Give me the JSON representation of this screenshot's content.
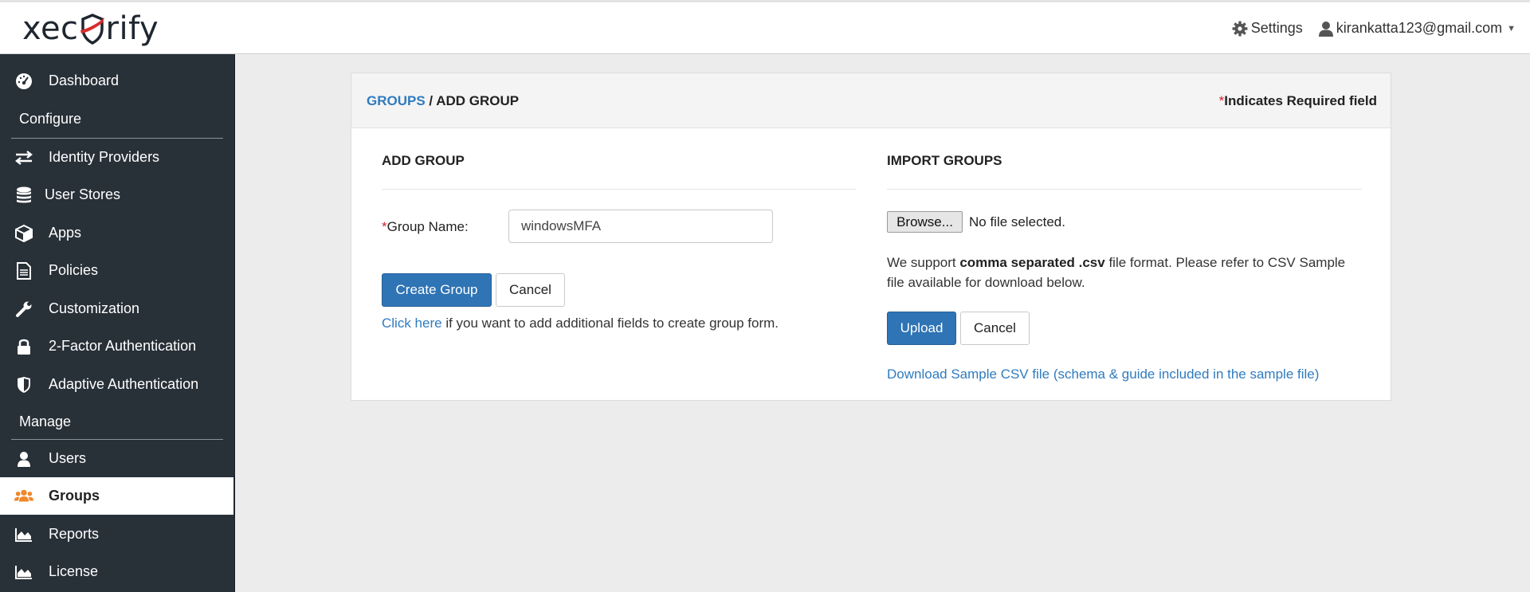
{
  "brand": {
    "logo_text_left": "xec",
    "logo_text_right": "rify",
    "accent": "#d92b2b"
  },
  "header": {
    "settings_label": "Settings",
    "user_email": "kirankatta123@gmail.com"
  },
  "sidebar": {
    "items": [
      {
        "label": "Dashboard",
        "icon": "dashboard-icon"
      },
      {
        "label": "Identity Providers",
        "icon": "exchange-icon"
      },
      {
        "label": "User Stores",
        "icon": "database-icon"
      },
      {
        "label": "Apps",
        "icon": "cube-icon"
      },
      {
        "label": "Policies",
        "icon": "document-icon"
      },
      {
        "label": "Customization",
        "icon": "wrench-icon"
      },
      {
        "label": "2-Factor Authentication",
        "icon": "lock-icon"
      },
      {
        "label": "Adaptive Authentication",
        "icon": "shield-icon"
      },
      {
        "label": "Users",
        "icon": "user-icon"
      },
      {
        "label": "Groups",
        "icon": "users-icon",
        "active": true
      },
      {
        "label": "Reports",
        "icon": "area-chart-icon"
      },
      {
        "label": "License",
        "icon": "area-chart-icon"
      }
    ],
    "sections": {
      "configure": "Configure",
      "manage": "Manage"
    },
    "active_icon_color": "#f0872b"
  },
  "panel": {
    "breadcrumb_root": "GROUPS",
    "breadcrumb_sep": " / ",
    "breadcrumb_current": "ADD GROUP",
    "required_star": "*",
    "required_note": "Indicates Required field"
  },
  "add_group": {
    "title": "ADD GROUP",
    "group_name_star": "*",
    "group_name_label": "Group Name:",
    "group_name_value": "windowsMFA",
    "create_label": "Create Group",
    "cancel_label": "Cancel",
    "helper_link": "Click here",
    "helper_text": " if you want to add additional fields to create group form."
  },
  "import_groups": {
    "title": "IMPORT GROUPS",
    "browse_label": "Browse...",
    "file_status": "No file selected.",
    "support_pre": "We support ",
    "support_bold": "comma separated .csv",
    "support_post": " file format. Please refer to CSV Sample file available for download below.",
    "upload_label": "Upload",
    "cancel_label": "Cancel",
    "download_link": "Download Sample CSV file (schema & guide included in the sample file)"
  },
  "colors": {
    "primary": "#2f74b5",
    "link": "#2f7bbf",
    "sidebar_bg": "#283038"
  }
}
